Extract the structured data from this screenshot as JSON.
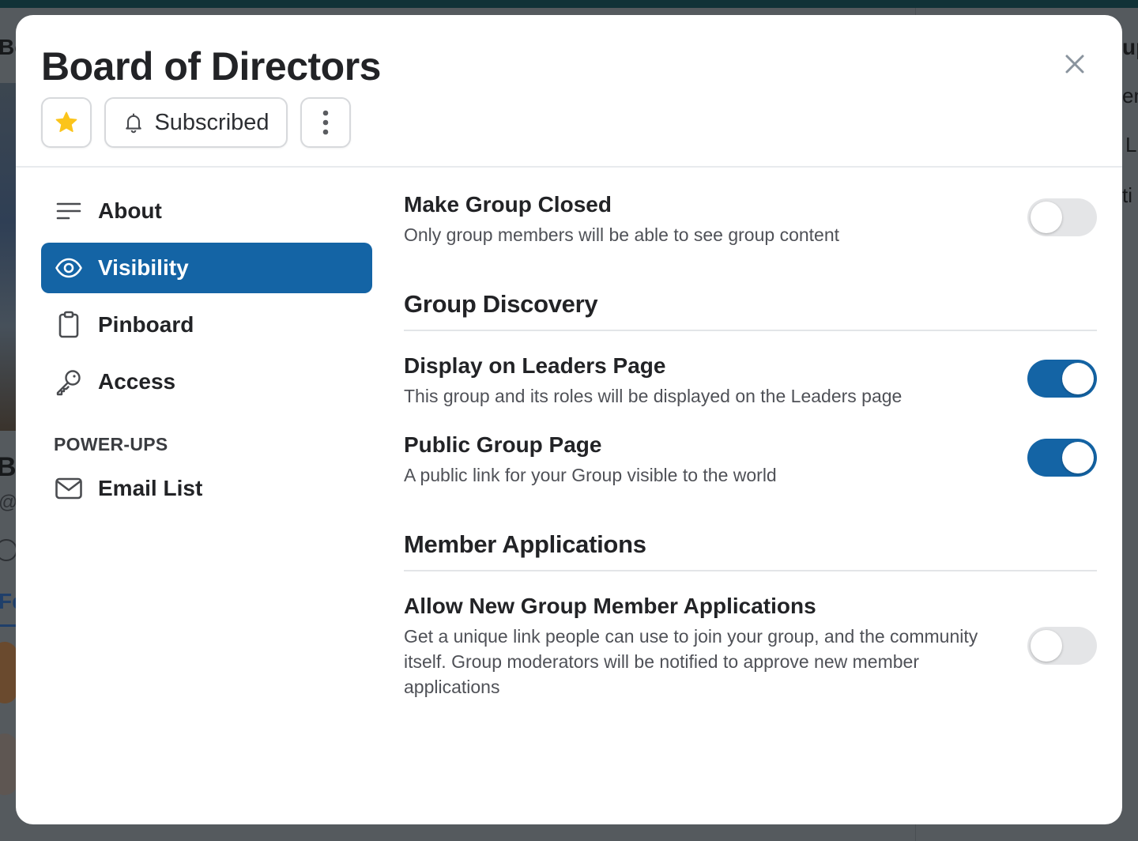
{
  "background": {
    "left_title_fragment": "Bo",
    "left_name_fragment": "B",
    "left_handle_fragment": "@",
    "left_tab_fragment": "Fe",
    "right_fragments": [
      "up",
      "em",
      "L",
      "ti"
    ]
  },
  "modal": {
    "title": "Board of Directors",
    "actions": {
      "favorite_icon": "star-icon",
      "subscribe_label": "Subscribed",
      "subscribe_icon": "bell-icon",
      "more_icon": "more-vertical-icon"
    },
    "close_icon": "close-icon"
  },
  "sidebar": {
    "items": [
      {
        "label": "About",
        "icon": "lines-icon",
        "active": false
      },
      {
        "label": "Visibility",
        "icon": "eye-icon",
        "active": true
      },
      {
        "label": "Pinboard",
        "icon": "clipboard-icon",
        "active": false
      },
      {
        "label": "Access",
        "icon": "key-icon",
        "active": false
      }
    ],
    "section_label": "POWER-UPS",
    "powerups": [
      {
        "label": "Email List",
        "icon": "mail-icon",
        "active": false
      }
    ]
  },
  "content": {
    "make_closed": {
      "title": "Make Group Closed",
      "description": "Only group members will be able to see group content",
      "enabled": false
    },
    "discovery": {
      "heading": "Group Discovery",
      "settings": [
        {
          "title": "Display on Leaders Page",
          "description": "This group and its roles will be displayed on the Leaders page",
          "enabled": true
        },
        {
          "title": "Public Group Page",
          "description": "A public link for your Group visible to the world",
          "enabled": true
        }
      ]
    },
    "applications": {
      "heading": "Member Applications",
      "settings": [
        {
          "title": "Allow New Group Member Applications",
          "description": "Get a unique link people can use to join your group, and the community itself. Group moderators will be notified to approve new member applications",
          "enabled": false
        }
      ]
    }
  },
  "colors": {
    "accent": "#1464a5",
    "toggle_off": "#e4e5e7",
    "star": "#fbc41b",
    "overlay": "#555a5e",
    "topbar": "#113237"
  }
}
